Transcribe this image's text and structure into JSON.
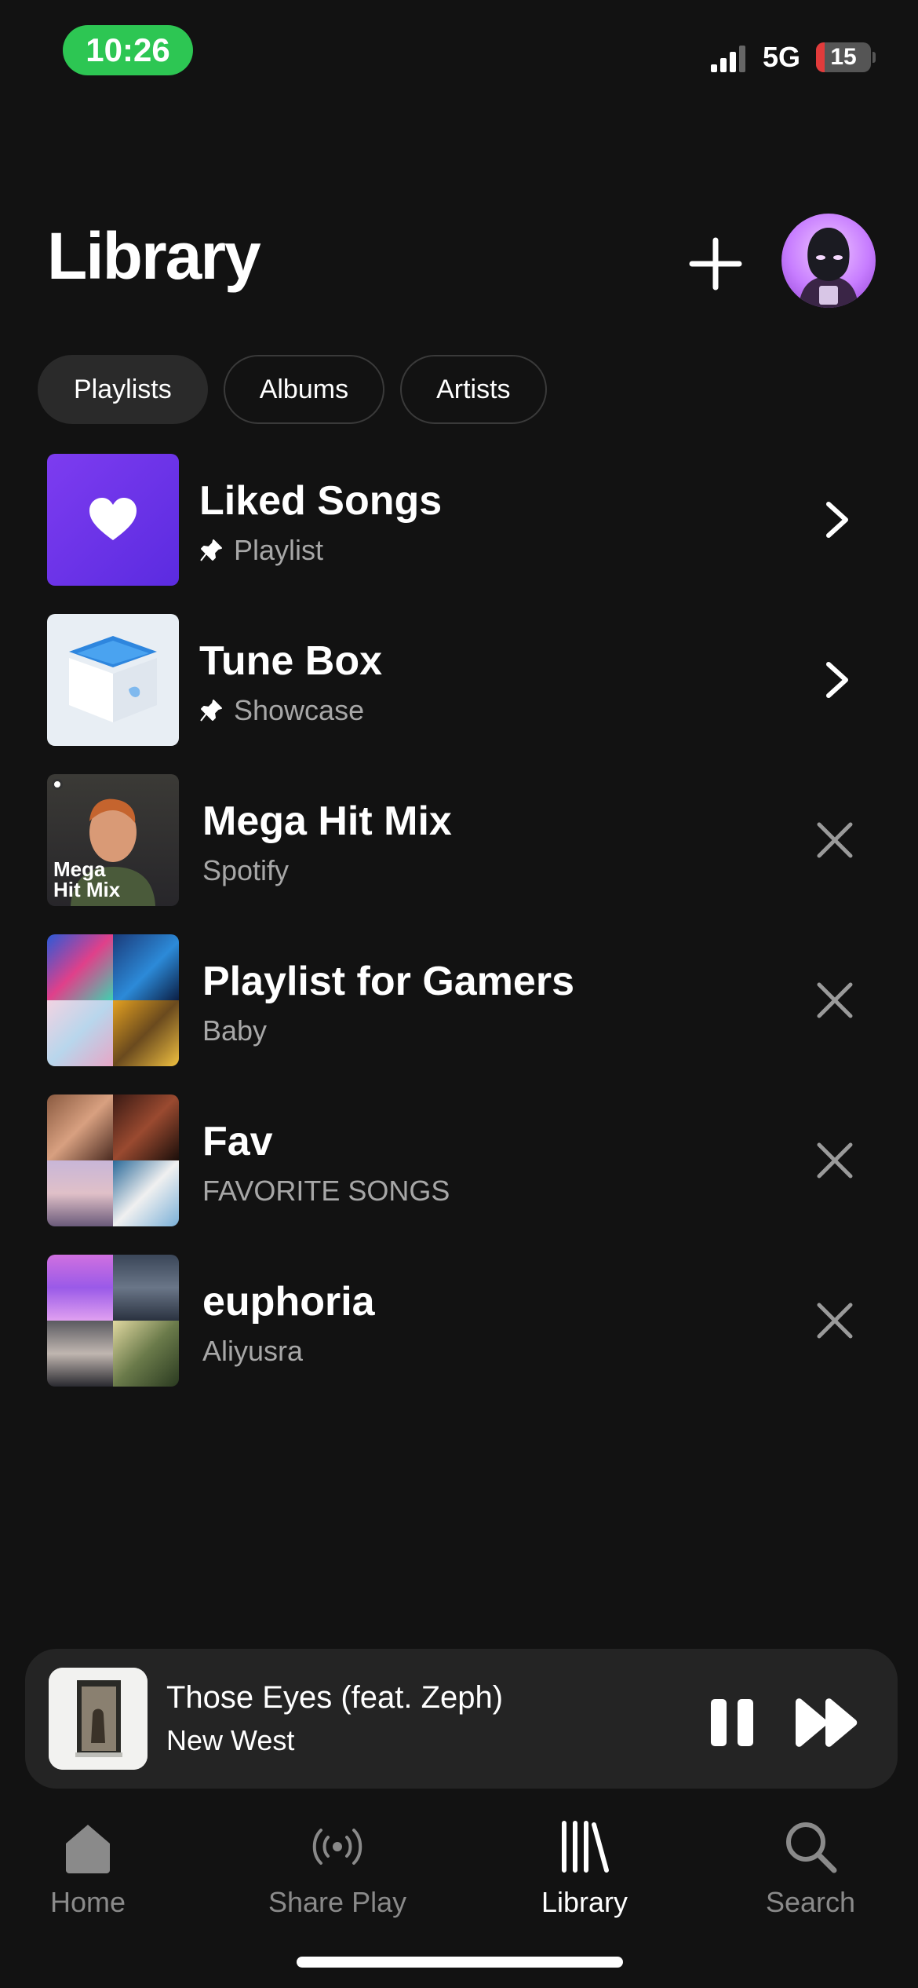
{
  "status_bar": {
    "time": "10:26",
    "network": "5G",
    "battery": "15",
    "battery_level": 0.15
  },
  "header": {
    "title": "Library"
  },
  "filters": [
    {
      "label": "Playlists",
      "active": true
    },
    {
      "label": "Albums",
      "active": false
    },
    {
      "label": "Artists",
      "active": false
    }
  ],
  "library_items": [
    {
      "title": "Liked Songs",
      "subtitle": "Playlist",
      "pinned": true,
      "action": "chevron"
    },
    {
      "title": "Tune Box",
      "subtitle": "Showcase",
      "pinned": true,
      "action": "chevron"
    },
    {
      "title": "Mega Hit Mix",
      "subtitle": "Spotify",
      "pinned": false,
      "action": "remove",
      "cover_text": "Mega Hit Mix"
    },
    {
      "title": "Playlist for Gamers",
      "subtitle": "Baby",
      "pinned": false,
      "action": "remove"
    },
    {
      "title": "Fav",
      "subtitle": "FAVORITE SONGS",
      "pinned": false,
      "action": "remove"
    },
    {
      "title": "euphoria",
      "subtitle": "Aliyusra",
      "pinned": false,
      "action": "remove"
    }
  ],
  "now_playing": {
    "title": "Those Eyes (feat. Zeph)",
    "artist": "New West"
  },
  "tabs": [
    {
      "label": "Home",
      "icon": "home-icon",
      "active": false
    },
    {
      "label": "Share Play",
      "icon": "broadcast-icon",
      "active": false
    },
    {
      "label": "Library",
      "icon": "library-icon",
      "active": true
    },
    {
      "label": "Search",
      "icon": "search-icon",
      "active": false
    }
  ],
  "colors": {
    "background": "#121212",
    "status_pill": "#2dc653",
    "liked_songs": "#7d3cf0",
    "muted_text": "#a7a7a7",
    "mini_player": "#242424"
  }
}
